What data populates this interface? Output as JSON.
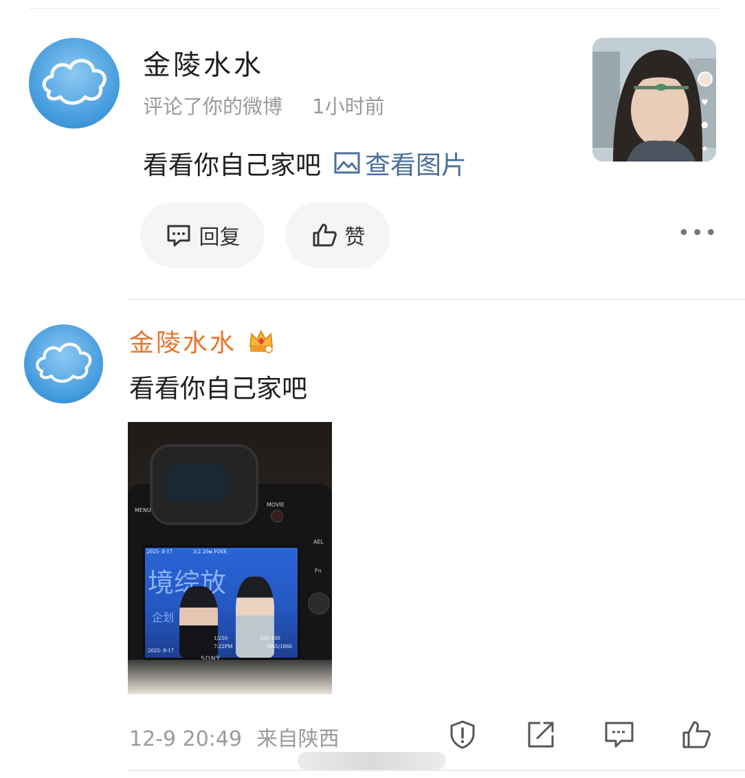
{
  "notification": {
    "username": "金陵水水",
    "action": "评论了你的微博",
    "time": "1小时前",
    "comment": "看看你自己家吧",
    "view_image_label": "查看图片",
    "reply_label": "回复",
    "like_label": "赞",
    "more_label": "•••"
  },
  "post": {
    "username": "金陵水水",
    "text": "看看你自己家吧",
    "timestamp": "12-9 20:49",
    "source": "来自陕西",
    "camera": {
      "menu": "MENU",
      "movie": "MOVIE",
      "ael": "AEL",
      "fn": "Fn",
      "date": "2025- 8-17",
      "quality": "3:2 20м FINE",
      "screen_big_text": "境综放",
      "screen_sub_text": "企划",
      "shutter": "1/250",
      "time_shot": "7:22PM",
      "iso": "ISO 100",
      "counter": "1865/1866",
      "date_bottom": "2025- 8-17",
      "brand": "SONY"
    }
  },
  "colors": {
    "username_post": "#e8742a",
    "link": "#4a6f9a",
    "muted": "#9a9a9a",
    "pill_bg": "#f5f5f5"
  },
  "icons": {
    "comment": "comment-icon",
    "thumb": "thumbs-up-icon",
    "image": "image-icon",
    "report": "report-icon",
    "share": "share-icon",
    "crown": "vip-crown-icon"
  }
}
